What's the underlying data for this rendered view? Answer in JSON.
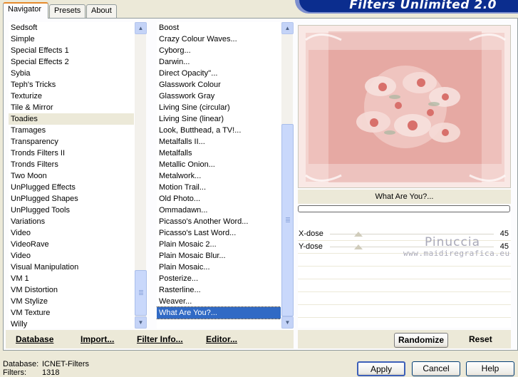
{
  "tabs": [
    {
      "label": "Navigator",
      "active": true
    },
    {
      "label": "Presets",
      "active": false
    },
    {
      "label": "About",
      "active": false
    }
  ],
  "app_title": "Filters Unlimited 2.0",
  "categories": [
    "Sedsoft",
    "Simple",
    "Special Effects 1",
    "Special Effects 2",
    "Sybia",
    "Teph's Tricks",
    "Texturize",
    "Tile & Mirror",
    "Toadies",
    "Tramages",
    "Transparency",
    "Tronds Filters II",
    "Tronds Filters",
    "Two Moon",
    "UnPlugged Effects",
    "UnPlugged Shapes",
    "UnPlugged Tools",
    "Variations",
    "Video",
    "VideoRave",
    "Video",
    "Visual Manipulation",
    "VM 1",
    "VM Distortion",
    "VM Stylize",
    "VM Texture",
    "Willy"
  ],
  "selected_category_index": 8,
  "filters": [
    "Boost",
    "Crazy Colour Waves...",
    "Cyborg...",
    "Darwin...",
    "Direct Opacity''...",
    "Glasswork Colour",
    "Glasswork Gray",
    "Living Sine (circular)",
    "Living Sine (linear)",
    "Look, Butthead, a TV!...",
    "Metalfalls II...",
    "Metalfalls",
    "Metallic Onion...",
    "Metalwork...",
    "Motion Trail...",
    "Old Photo...",
    "Ommadawn...",
    "Picasso's Another Word...",
    "Picasso's Last Word...",
    "Plain Mosaic 2...",
    "Plain Mosaic Blur...",
    "Plain Mosaic...",
    "Posterize...",
    "Rasterline...",
    "Weaver...",
    "What Are You?..."
  ],
  "selected_filter_index": 25,
  "filter_title": "What Are You?...",
  "params": [
    {
      "label": "X-dose",
      "value": "45",
      "fraction": 0.176
    },
    {
      "label": "Y-dose",
      "value": "45",
      "fraction": 0.176
    }
  ],
  "watermark": {
    "name": "Pinuccia",
    "url": "www.maidiregrafica.eu"
  },
  "toolbar": {
    "database": "Database",
    "import": "Import...",
    "filter_info": "Filter Info...",
    "editor": "Editor...",
    "randomize": "Randomize",
    "reset": "Reset"
  },
  "buttons": {
    "apply": "Apply",
    "cancel": "Cancel",
    "help": "Help"
  },
  "status": {
    "database_label": "Database:",
    "database_value": "ICNET-Filters",
    "filters_label": "Filters:",
    "filters_value": "1318"
  },
  "colors": {
    "accent_tab": "#e68b2c",
    "selection": "#316ac5",
    "banner": "#0b2d8e",
    "preview_bg": "#f5d6d3"
  }
}
